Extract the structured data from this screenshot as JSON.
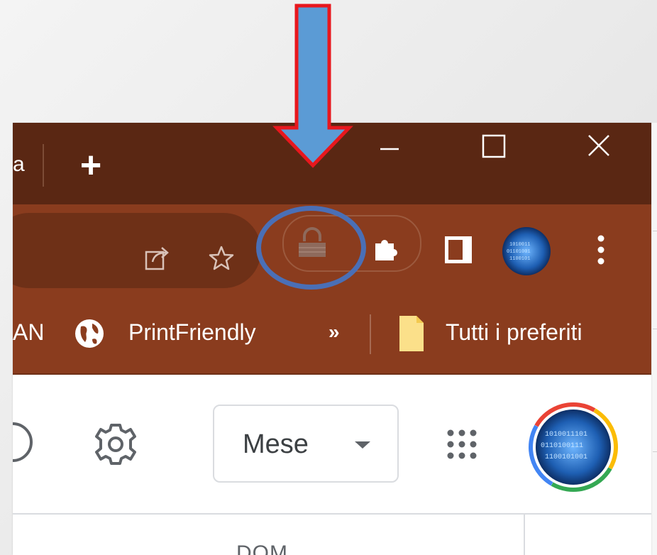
{
  "browser": {
    "tab_fragment": "a",
    "new_tab_label": "+",
    "window_controls": [
      "minimize-icon",
      "maximize-icon",
      "close-icon"
    ]
  },
  "toolbar": {
    "omnibox_icons": [
      "share-icon",
      "bookmark-star-icon"
    ],
    "extension_icons": [
      "lock-icon",
      "puzzle-extensions-icon"
    ],
    "side_panel_icon": "side-panel-icon",
    "profile_icon": "profile-avatar",
    "menu_icon": "more-vert-icon"
  },
  "bookmarks": {
    "fragment_label": "AN",
    "items": [
      {
        "label": "PrintFriendly",
        "icon": "globe-icon"
      }
    ],
    "overflow_label": "»",
    "all_bookmarks": {
      "label": "Tutti i preferiti",
      "icon": "folder-icon"
    }
  },
  "calendar": {
    "view_selector_label": "Mese",
    "day_label": "DOM",
    "icons": [
      "help-icon",
      "settings-gear-icon",
      "apps-grid-icon",
      "account-avatar"
    ]
  },
  "annotation": {
    "arrow_fill": "#5b9bd5",
    "arrow_outline": "#e8171d",
    "ring_color": "#4a6fb6"
  },
  "colors": {
    "titlebar": "#5a2713",
    "toolbar": "#8a3c1e",
    "omnibox": "#6e3017"
  }
}
